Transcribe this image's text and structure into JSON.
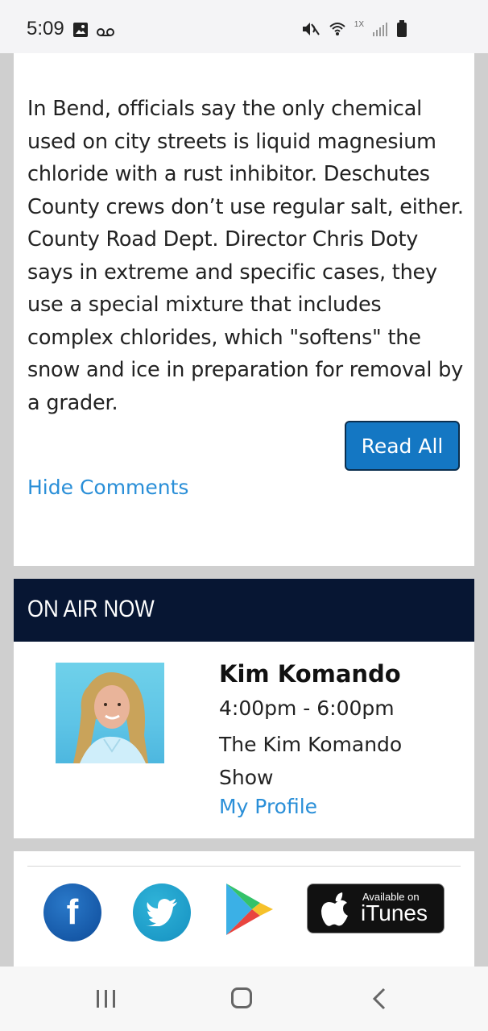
{
  "status_bar": {
    "time": "5:09",
    "icons_left": [
      "image-icon",
      "voicemail-icon"
    ],
    "icons_right": [
      "mute-icon",
      "wifi-icon",
      "signal-icon",
      "battery-icon"
    ],
    "network_label": "1X"
  },
  "article": {
    "body": "In Bend, officials say the only chemical used on city streets is liquid magnesium chloride with a rust inhibitor. Deschutes County crews don’t use regular salt, either. County Road Dept. Director Chris Doty says in extreme and specific cases, they use a special mixture that includes complex chlorides, which \"softens\" the snow and ice in preparation for removal by a grader.",
    "read_all_label": "Read All",
    "hide_comments_label": "Hide Comments"
  },
  "on_air": {
    "header": "ON AIR NOW",
    "host_name": "Kim Komando",
    "time": "4:00pm - 6:00pm",
    "show": "The Kim Komando Show",
    "profile_link": "My Profile"
  },
  "social": {
    "facebook": "f",
    "itunes_small": "Available on",
    "itunes_big": "iTunes"
  },
  "nav": {
    "items": [
      "recents-icon",
      "home-icon",
      "back-icon"
    ]
  }
}
